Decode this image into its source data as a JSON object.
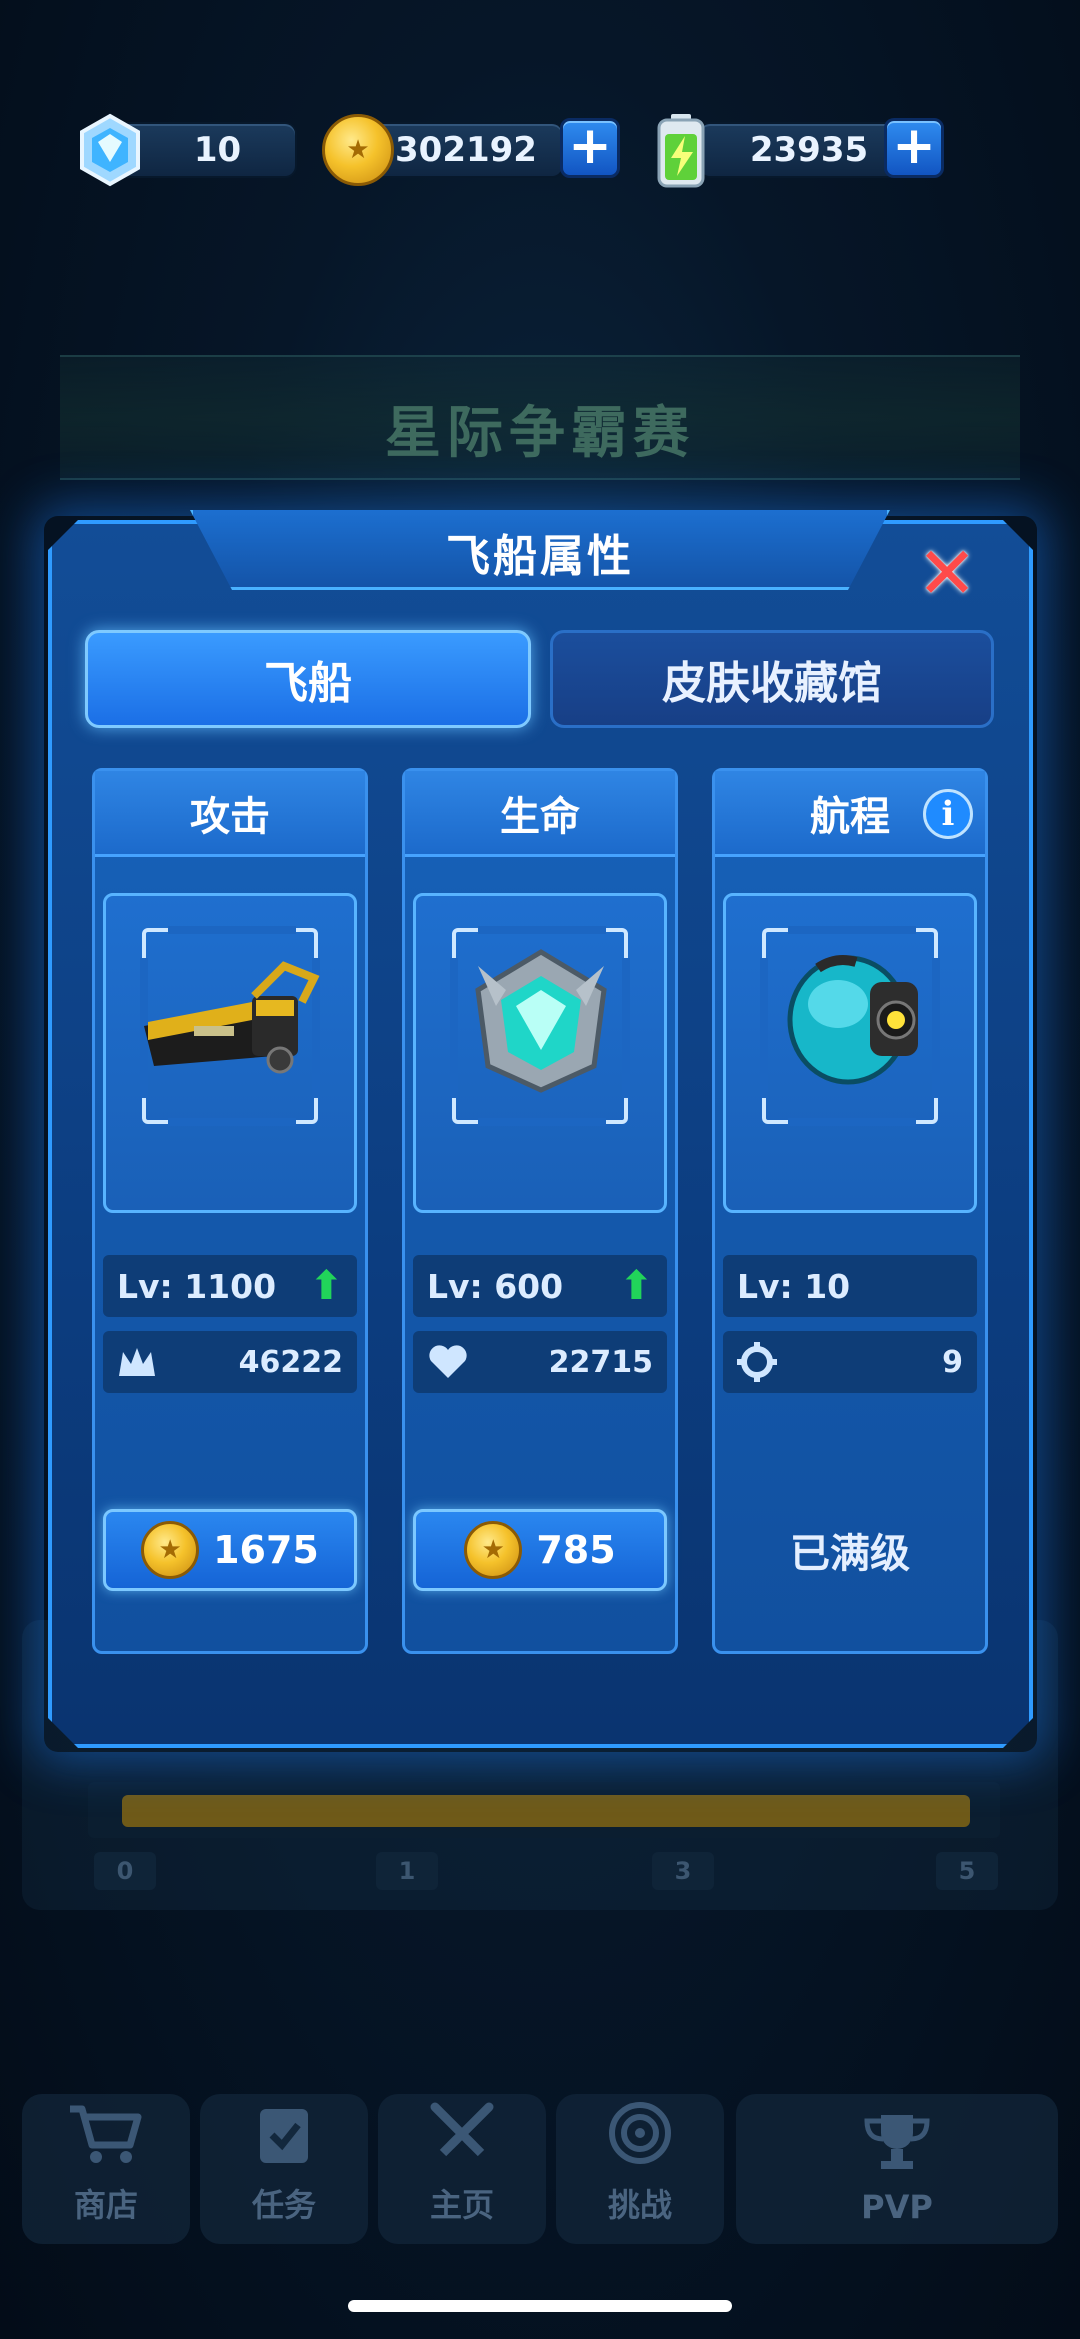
{
  "resources": {
    "gems": {
      "value": "10",
      "icon": "crystal-icon"
    },
    "coins": {
      "value": "302192",
      "icon": "coin-icon",
      "add": "+"
    },
    "energy": {
      "value": "23935",
      "icon": "battery-icon",
      "add": "+"
    }
  },
  "background": {
    "title": "星际争霸赛",
    "progress_labels": [
      "0",
      "1",
      "3",
      "5"
    ],
    "progress_fill": 1.0
  },
  "modal": {
    "title": "飞船属性",
    "close": "✕",
    "tabs": [
      {
        "label": "飞船",
        "active": true
      },
      {
        "label": "皮肤收藏馆",
        "active": false
      }
    ],
    "cards": [
      {
        "title": "攻击",
        "level": "Lv: 1100",
        "stat_icon": "crown-icon",
        "stat_value": "46222",
        "cost": "1675",
        "upgradable": true
      },
      {
        "title": "生命",
        "level": "Lv: 600",
        "stat_icon": "heart-icon",
        "stat_value": "22715",
        "cost": "785",
        "upgradable": true
      },
      {
        "title": "航程",
        "level": "Lv: 10",
        "stat_icon": "crosshair-icon",
        "stat_value": "9",
        "status": "已满级",
        "upgradable": false,
        "info": "i"
      }
    ]
  },
  "nav": [
    {
      "label": "商店",
      "icon": "cart-icon"
    },
    {
      "label": "任务",
      "icon": "clipboard-icon"
    },
    {
      "label": "主页",
      "icon": "swords-icon"
    },
    {
      "label": "挑战",
      "icon": "target-icon"
    },
    {
      "label": "PVP",
      "icon": "trophy-icon"
    }
  ],
  "colors": {
    "accent": "#2f9bff",
    "modal_bg": "#124d97",
    "upgrade_arrow": "#21d45a",
    "close_red": "#ff4a4a",
    "coin_gold": "#f5c22b"
  }
}
